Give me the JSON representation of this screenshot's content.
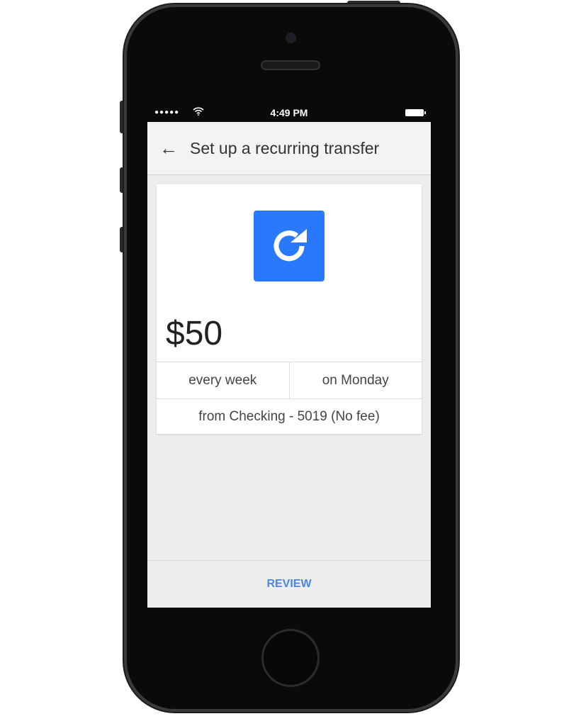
{
  "status_bar": {
    "signal": "●●●●●",
    "wifi_icon": "wifi-icon",
    "time": "4:49 PM",
    "battery_icon": "battery-icon"
  },
  "app_bar": {
    "back_icon": "arrow-left-icon",
    "back_glyph": "←",
    "title": "Set up a recurring transfer"
  },
  "card": {
    "icon": "refresh-icon",
    "icon_color": "#2979ff",
    "amount": "$50",
    "frequency": "every week",
    "day": "on Monday",
    "source": "from Checking - 5019 (No fee)"
  },
  "footer": {
    "review_label": "REVIEW",
    "accent": "#4a86e8"
  }
}
